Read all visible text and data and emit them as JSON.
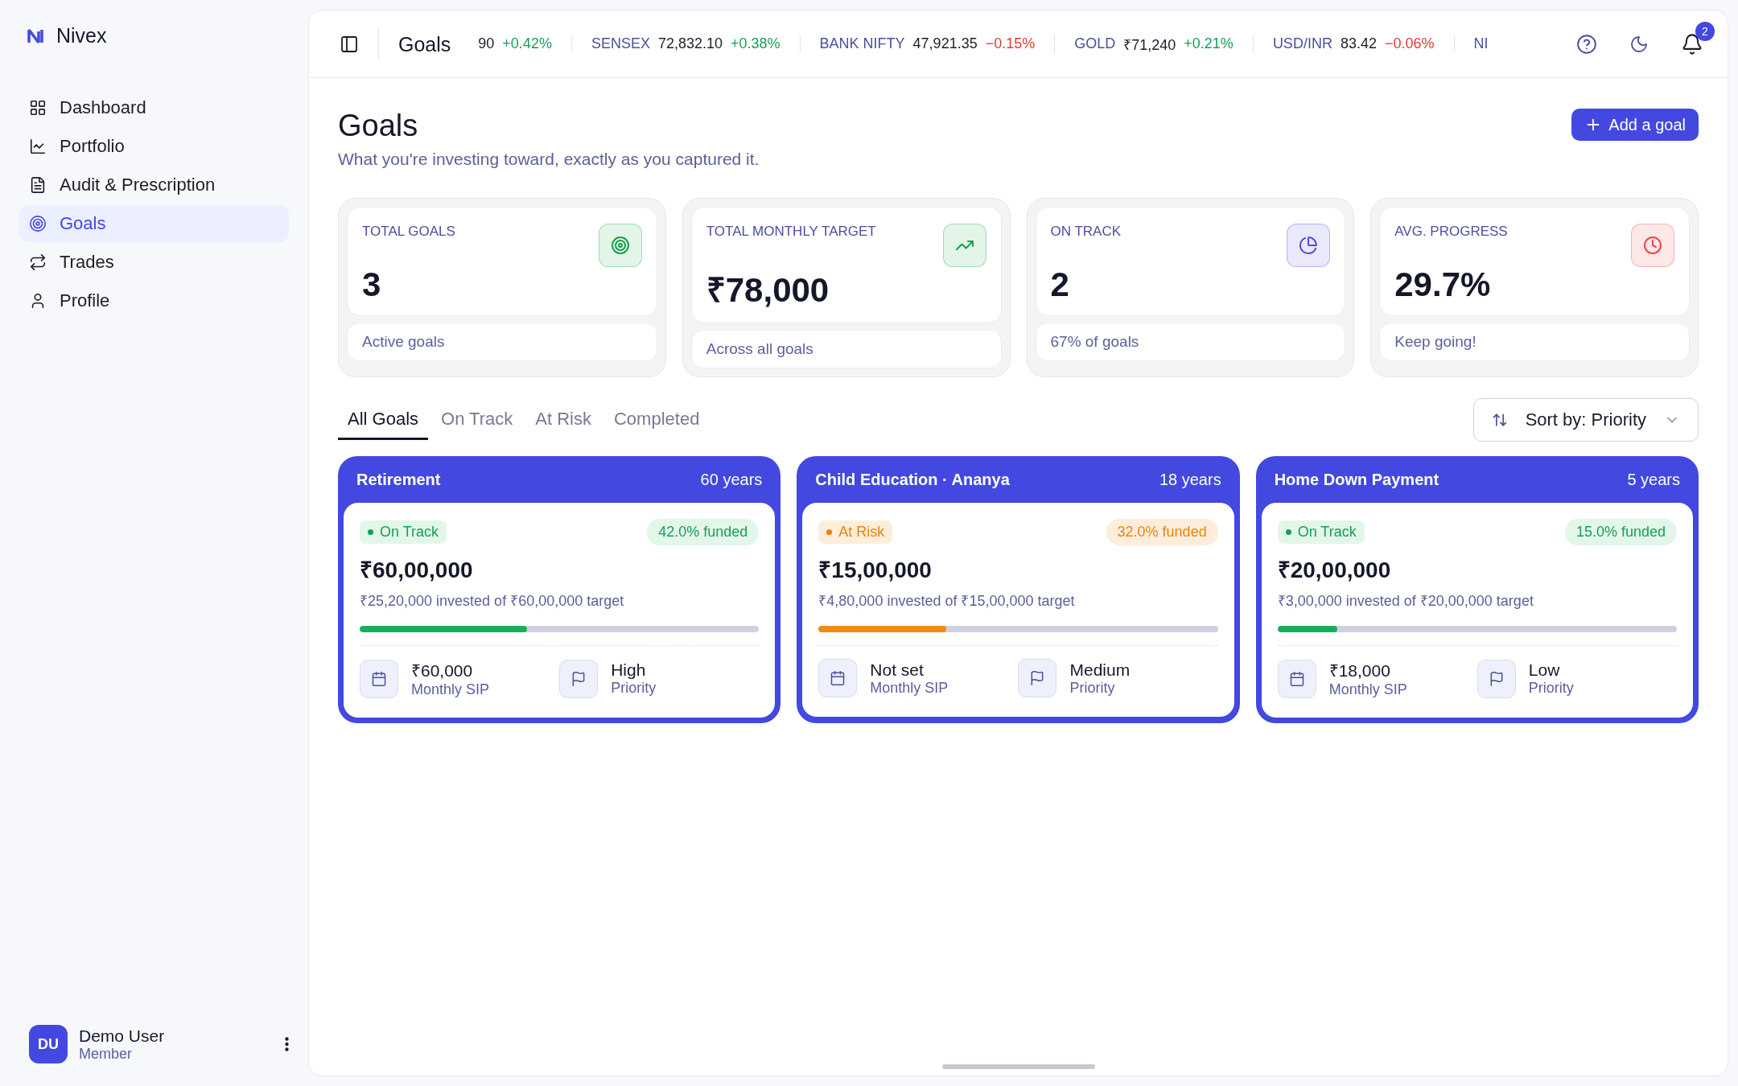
{
  "brand": {
    "name": "Nivex"
  },
  "sidebar": {
    "items": [
      {
        "label": "Dashboard",
        "selected": false
      },
      {
        "label": "Portfolio",
        "selected": false
      },
      {
        "label": "Audit & Prescription",
        "selected": false
      },
      {
        "label": "Goals",
        "selected": true
      },
      {
        "label": "Trades",
        "selected": false
      },
      {
        "label": "Profile",
        "selected": false
      }
    ]
  },
  "user": {
    "initials": "DU",
    "name": "Demo User",
    "role": "Member"
  },
  "topbar": {
    "title": "Goals",
    "tickers": [
      {
        "value": "90",
        "change": "+0.42%",
        "kind": "gain"
      },
      {
        "name": "SENSEX",
        "value": "72,832.10",
        "change": "+0.38%",
        "kind": "gain"
      },
      {
        "name": "BANK NIFTY",
        "value": "47,921.35",
        "change": "−0.15%",
        "kind": "loss"
      },
      {
        "name": "GOLD",
        "value": "₹71,240",
        "change": "+0.21%",
        "kind": "gain"
      },
      {
        "name": "USD/INR",
        "value": "83.42",
        "change": "−0.06%",
        "kind": "loss"
      },
      {
        "name": "NI"
      }
    ],
    "notifications": "2"
  },
  "page": {
    "title": "Goals",
    "subtitle": "What you're investing toward, exactly as you captured it.",
    "add_button": "Add a goal"
  },
  "stats": [
    {
      "label": "TOTAL GOALS",
      "value": "3",
      "note": "Active goals",
      "color": "#16a34a"
    },
    {
      "label": "TOTAL MONTHLY TARGET",
      "value": "₹78,000",
      "note": "Across all goals",
      "color": "#16a34a"
    },
    {
      "label": "ON TRACK",
      "value": "2",
      "note": "67% of goals",
      "color": "#4f46e5"
    },
    {
      "label": "AVG. PROGRESS",
      "value": "29.7%",
      "note": "Keep going!",
      "color": "#ef4444"
    }
  ],
  "tabs": [
    {
      "label": "All Goals",
      "selected": true
    },
    {
      "label": "On Track",
      "selected": false
    },
    {
      "label": "At Risk",
      "selected": false
    },
    {
      "label": "Completed",
      "selected": false
    }
  ],
  "sort": {
    "label": "Sort by: Priority"
  },
  "goals": [
    {
      "name": "Retirement",
      "horizon": "60 years",
      "status": "On Track",
      "kind": "on_track",
      "funded": "42.0% funded",
      "amount": "₹60,00,000",
      "detail": "₹25,20,000 invested of ₹60,00,000 target",
      "level": 0.42,
      "sip": "₹60,000",
      "sip_label": "Monthly SIP",
      "priority": "High",
      "priority_label": "Priority"
    },
    {
      "name": "Child Education · Ananya",
      "horizon": "18 years",
      "status": "At Risk",
      "kind": "at_risk",
      "funded": "32.0% funded",
      "amount": "₹15,00,000",
      "detail": "₹4,80,000 invested of ₹15,00,000 target",
      "level": 0.32,
      "sip": "Not set",
      "sip_label": "Monthly SIP",
      "priority": "Medium",
      "priority_label": "Priority"
    },
    {
      "name": "Home Down Payment",
      "horizon": "5 years",
      "status": "On Track",
      "kind": "on_track",
      "funded": "15.0% funded",
      "amount": "₹20,00,000",
      "detail": "₹3,00,000 invested of ₹20,00,000 target",
      "level": 0.15,
      "sip": "₹18,000",
      "sip_label": "Monthly SIP",
      "priority": "Low",
      "priority_label": "Priority"
    }
  ]
}
